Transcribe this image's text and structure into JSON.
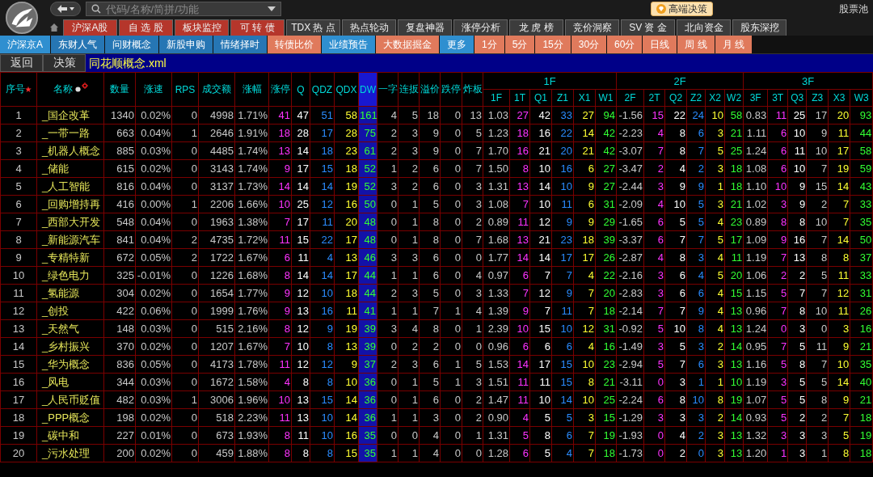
{
  "toolbar": {
    "search": {
      "placeholder": "代码/名称/简拼/功能"
    },
    "badge": "高端决策",
    "link": "股票池"
  },
  "tabs": [
    {
      "label": "沪深A股",
      "color": "#b5362b"
    },
    {
      "label": "自 选 股",
      "color": "#b5362b"
    },
    {
      "label": "板块监控",
      "color": "#b5362b"
    },
    {
      "label": "可 转 债",
      "color": "#b5362b"
    },
    {
      "label": "TDX 热 点",
      "color": "#3c3c3c"
    },
    {
      "label": "热点轮动",
      "color": "#3c3c3c"
    },
    {
      "label": "复盘神器",
      "color": "#3c3c3c"
    },
    {
      "label": "涨停分析",
      "color": "#3c3c3c"
    },
    {
      "label": "龙 虎 榜",
      "color": "#3c3c3c"
    },
    {
      "label": "竞价洞察",
      "color": "#3c3c3c"
    },
    {
      "label": "SV 资 金",
      "color": "#3c3c3c"
    },
    {
      "label": "北向资金",
      "color": "#3c3c3c"
    },
    {
      "label": "股东深挖",
      "color": "#3c3c3c"
    }
  ],
  "subtabs": [
    {
      "label": "沪深京A",
      "color": "#2f8fd0"
    },
    {
      "label": "东财人气",
      "color": "#2676b4"
    },
    {
      "label": "问财概念",
      "color": "#2676b4"
    },
    {
      "label": "新股申购",
      "color": "#2676b4"
    },
    {
      "label": "情绪择时",
      "color": "#2676b4"
    },
    {
      "label": "转债比价",
      "color": "#e07a5c"
    },
    {
      "label": "业绩预告",
      "color": "#2f8fd0"
    },
    {
      "label": "大数据掘金",
      "color": "#e07a5c"
    },
    {
      "label": "更多",
      "color": "#2f8fd0"
    },
    {
      "label": "1分",
      "color": "#e07a5c"
    },
    {
      "label": "5分",
      "color": "#e07a5c"
    },
    {
      "label": "15分",
      "color": "#e07a5c"
    },
    {
      "label": "30分",
      "color": "#e07a5c"
    },
    {
      "label": "60分",
      "color": "#e07a5c"
    },
    {
      "label": "日线",
      "color": "#e07a5c"
    },
    {
      "label": "周 线",
      "color": "#e07a5c"
    },
    {
      "label": "月 线",
      "color": "#e07a5c"
    }
  ],
  "nav_buttons": [
    "返回",
    "决策"
  ],
  "file_title": "同花顺概念.xml",
  "table": {
    "columns": [
      {
        "label": "序号",
        "mark": "★",
        "kind": "index",
        "selected": false
      },
      {
        "label": "名称",
        "kind": "name",
        "selected": false
      },
      {
        "label": "数量",
        "kind": "num",
        "selected": false
      },
      {
        "label": "涨速",
        "kind": "num",
        "selected": false
      },
      {
        "label": "RPS",
        "kind": "num",
        "selected": false
      },
      {
        "label": "成交额",
        "kind": "num",
        "selected": false
      },
      {
        "label": "涨幅",
        "kind": "num",
        "selected": false
      },
      {
        "label": "涨停",
        "kind": "limit",
        "selected": false
      },
      {
        "label": "Q",
        "kind": "strong",
        "selected": false
      },
      {
        "label": "QDZ",
        "kind": "rise",
        "selected": false
      },
      {
        "label": "QDX",
        "kind": "fall",
        "selected": false
      },
      {
        "label": "DW",
        "kind": "sum",
        "selected": true
      },
      {
        "label": "一字",
        "kind": "num",
        "selected": false
      },
      {
        "label": "连扳",
        "kind": "num",
        "selected": false
      },
      {
        "label": "溢价",
        "kind": "num",
        "selected": false
      },
      {
        "label": "跌停",
        "kind": "num",
        "selected": false
      },
      {
        "label": "炸板",
        "kind": "num",
        "selected": false
      }
    ],
    "groups": [
      {
        "label": "1F",
        "columns": [
          {
            "label": "1F",
            "kind": "num"
          },
          {
            "label": "1T",
            "kind": "limit"
          },
          {
            "label": "Q1",
            "kind": "strong"
          },
          {
            "label": "Z1",
            "kind": "rise"
          },
          {
            "label": "X1",
            "kind": "fall"
          },
          {
            "label": "W1",
            "kind": "sum"
          }
        ]
      },
      {
        "label": "2F",
        "columns": [
          {
            "label": "2F",
            "kind": "num"
          },
          {
            "label": "2T",
            "kind": "limit"
          },
          {
            "label": "Q2",
            "kind": "strong"
          },
          {
            "label": "Z2",
            "kind": "rise"
          },
          {
            "label": "X2",
            "kind": "fall"
          },
          {
            "label": "W2",
            "kind": "sum"
          }
        ]
      },
      {
        "label": "3F",
        "columns": [
          {
            "label": "3F",
            "kind": "num"
          },
          {
            "label": "3T",
            "kind": "limit"
          },
          {
            "label": "Q3",
            "kind": "strong"
          },
          {
            "label": "Z3",
            "kind": "num"
          },
          {
            "label": "X3",
            "kind": "fall"
          },
          {
            "label": "W3",
            "kind": "sum"
          }
        ]
      }
    ],
    "rows": [
      [
        "1",
        "_国企改革",
        "1340",
        "0.02%",
        "0",
        "4998",
        "1.71%",
        "41",
        "47",
        "51",
        "58",
        "161",
        "4",
        "5",
        "18",
        "0",
        "13",
        "1.03",
        "27",
        "42",
        "33",
        "27",
        "94",
        "-1.56",
        "15",
        "22",
        "24",
        "10",
        "58",
        "0.83",
        "11",
        "25",
        "17",
        "20",
        "93"
      ],
      [
        "2",
        "_一带一路",
        "663",
        "0.04%",
        "1",
        "2646",
        "1.91%",
        "18",
        "28",
        "17",
        "28",
        "75",
        "2",
        "3",
        "9",
        "0",
        "5",
        "1.23",
        "18",
        "16",
        "22",
        "14",
        "42",
        "-2.23",
        "4",
        "8",
        "6",
        "3",
        "21",
        "1.11",
        "6",
        "10",
        "9",
        "11",
        "44"
      ],
      [
        "3",
        "_机器人概念",
        "885",
        "0.03%",
        "0",
        "4485",
        "1.74%",
        "13",
        "14",
        "18",
        "23",
        "61",
        "2",
        "3",
        "9",
        "0",
        "7",
        "1.70",
        "16",
        "21",
        "20",
        "21",
        "42",
        "-3.07",
        "7",
        "8",
        "7",
        "5",
        "25",
        "1.24",
        "6",
        "11",
        "10",
        "17",
        "58"
      ],
      [
        "4",
        "_储能",
        "615",
        "0.02%",
        "0",
        "3143",
        "1.74%",
        "9",
        "17",
        "15",
        "18",
        "52",
        "1",
        "2",
        "6",
        "0",
        "7",
        "1.50",
        "8",
        "10",
        "16",
        "6",
        "27",
        "-3.47",
        "2",
        "4",
        "2",
        "3",
        "18",
        "1.08",
        "6",
        "10",
        "7",
        "19",
        "59"
      ],
      [
        "5",
        "_人工智能",
        "816",
        "0.04%",
        "0",
        "3137",
        "1.73%",
        "14",
        "14",
        "14",
        "19",
        "52",
        "3",
        "2",
        "6",
        "0",
        "3",
        "1.31",
        "13",
        "14",
        "10",
        "9",
        "27",
        "-2.44",
        "3",
        "9",
        "9",
        "1",
        "18",
        "1.10",
        "10",
        "9",
        "15",
        "14",
        "43"
      ],
      [
        "6",
        "_回购增持再",
        "416",
        "0.00%",
        "1",
        "2206",
        "1.66%",
        "10",
        "25",
        "12",
        "16",
        "50",
        "0",
        "1",
        "5",
        "0",
        "3",
        "1.08",
        "7",
        "10",
        "11",
        "6",
        "31",
        "-2.09",
        "4",
        "10",
        "5",
        "3",
        "21",
        "1.02",
        "3",
        "9",
        "2",
        "7",
        "33"
      ],
      [
        "7",
        "_西部大开发",
        "548",
        "0.04%",
        "0",
        "1963",
        "1.38%",
        "7",
        "17",
        "11",
        "20",
        "48",
        "0",
        "1",
        "8",
        "0",
        "2",
        "0.89",
        "11",
        "12",
        "9",
        "9",
        "29",
        "-1.65",
        "6",
        "5",
        "5",
        "4",
        "23",
        "0.89",
        "8",
        "8",
        "10",
        "7",
        "35"
      ],
      [
        "8",
        "_新能源汽车",
        "841",
        "0.04%",
        "2",
        "4735",
        "1.72%",
        "11",
        "15",
        "22",
        "17",
        "48",
        "0",
        "1",
        "8",
        "0",
        "7",
        "1.68",
        "13",
        "21",
        "23",
        "18",
        "39",
        "-3.37",
        "6",
        "7",
        "7",
        "5",
        "17",
        "1.09",
        "9",
        "16",
        "7",
        "14",
        "50"
      ],
      [
        "9",
        "_专精特新",
        "672",
        "0.05%",
        "2",
        "1722",
        "1.67%",
        "6",
        "11",
        "4",
        "13",
        "46",
        "3",
        "3",
        "6",
        "0",
        "0",
        "1.77",
        "14",
        "14",
        "17",
        "17",
        "26",
        "-2.87",
        "4",
        "8",
        "3",
        "4",
        "11",
        "1.19",
        "7",
        "13",
        "8",
        "8",
        "37"
      ],
      [
        "10",
        "_绿色电力",
        "325",
        "-0.01%",
        "0",
        "1226",
        "1.68%",
        "8",
        "14",
        "14",
        "17",
        "44",
        "1",
        "1",
        "6",
        "0",
        "4",
        "0.97",
        "6",
        "7",
        "7",
        "4",
        "22",
        "-2.16",
        "3",
        "6",
        "4",
        "5",
        "20",
        "1.06",
        "2",
        "2",
        "5",
        "11",
        "33"
      ],
      [
        "11",
        "_氢能源",
        "304",
        "0.02%",
        "0",
        "1654",
        "1.77%",
        "9",
        "12",
        "10",
        "18",
        "44",
        "2",
        "3",
        "5",
        "0",
        "3",
        "1.33",
        "7",
        "12",
        "9",
        "7",
        "20",
        "-2.83",
        "3",
        "6",
        "6",
        "4",
        "15",
        "1.15",
        "5",
        "7",
        "7",
        "12",
        "31"
      ],
      [
        "12",
        "_创投",
        "422",
        "0.06%",
        "0",
        "1999",
        "1.76%",
        "9",
        "13",
        "16",
        "11",
        "41",
        "1",
        "1",
        "7",
        "1",
        "4",
        "1.39",
        "9",
        "7",
        "11",
        "7",
        "18",
        "-2.14",
        "7",
        "7",
        "9",
        "4",
        "13",
        "0.96",
        "7",
        "8",
        "10",
        "11",
        "26"
      ],
      [
        "13",
        "_天然气",
        "148",
        "0.03%",
        "0",
        "515",
        "2.16%",
        "8",
        "12",
        "9",
        "19",
        "39",
        "3",
        "4",
        "8",
        "0",
        "1",
        "2.39",
        "10",
        "15",
        "10",
        "12",
        "31",
        "-0.92",
        "5",
        "10",
        "8",
        "4",
        "13",
        "1.24",
        "0",
        "3",
        "0",
        "3",
        "16"
      ],
      [
        "14",
        "_乡村振兴",
        "370",
        "0.02%",
        "0",
        "1207",
        "1.67%",
        "7",
        "10",
        "8",
        "13",
        "39",
        "0",
        "2",
        "2",
        "0",
        "0",
        "0.96",
        "6",
        "6",
        "6",
        "4",
        "16",
        "-1.49",
        "3",
        "5",
        "3",
        "2",
        "14",
        "0.95",
        "7",
        "5",
        "11",
        "9",
        "21"
      ],
      [
        "15",
        "_华为概念",
        "836",
        "0.05%",
        "0",
        "4173",
        "1.78%",
        "11",
        "12",
        "12",
        "9",
        "37",
        "2",
        "3",
        "6",
        "1",
        "5",
        "1.53",
        "14",
        "17",
        "15",
        "10",
        "23",
        "-2.94",
        "5",
        "7",
        "6",
        "3",
        "13",
        "1.16",
        "5",
        "8",
        "7",
        "10",
        "35"
      ],
      [
        "16",
        "_风电",
        "344",
        "0.03%",
        "0",
        "1672",
        "1.58%",
        "4",
        "8",
        "8",
        "10",
        "36",
        "0",
        "1",
        "5",
        "1",
        "3",
        "1.51",
        "11",
        "11",
        "15",
        "8",
        "21",
        "-3.11",
        "0",
        "3",
        "1",
        "1",
        "10",
        "1.19",
        "3",
        "5",
        "5",
        "14",
        "40"
      ],
      [
        "17",
        "_人民币贬值",
        "482",
        "0.03%",
        "1",
        "3006",
        "1.96%",
        "10",
        "13",
        "15",
        "14",
        "36",
        "0",
        "1",
        "6",
        "0",
        "2",
        "1.47",
        "11",
        "10",
        "14",
        "10",
        "25",
        "-2.24",
        "6",
        "8",
        "10",
        "8",
        "19",
        "1.07",
        "5",
        "5",
        "8",
        "9",
        "21"
      ],
      [
        "18",
        "_PPP概念",
        "198",
        "0.02%",
        "0",
        "518",
        "2.23%",
        "11",
        "13",
        "10",
        "14",
        "36",
        "1",
        "1",
        "3",
        "0",
        "2",
        "0.90",
        "4",
        "5",
        "5",
        "3",
        "15",
        "-1.29",
        "3",
        "3",
        "3",
        "2",
        "14",
        "0.93",
        "5",
        "2",
        "2",
        "7",
        "18"
      ],
      [
        "19",
        "_碳中和",
        "227",
        "0.01%",
        "0",
        "673",
        "1.93%",
        "8",
        "11",
        "10",
        "16",
        "35",
        "0",
        "0",
        "4",
        "0",
        "1",
        "1.31",
        "5",
        "8",
        "6",
        "7",
        "19",
        "-1.93",
        "0",
        "4",
        "2",
        "3",
        "13",
        "1.32",
        "3",
        "3",
        "3",
        "5",
        "19"
      ],
      [
        "20",
        "_污水处理",
        "200",
        "0.02%",
        "0",
        "459",
        "1.88%",
        "8",
        "8",
        "8",
        "15",
        "35",
        "1",
        "1",
        "4",
        "0",
        "0",
        "1.28",
        "6",
        "5",
        "4",
        "7",
        "18",
        "-1.73",
        "0",
        "2",
        "0",
        "3",
        "13",
        "1.20",
        "1",
        "3",
        "1",
        "8",
        "18"
      ]
    ]
  }
}
